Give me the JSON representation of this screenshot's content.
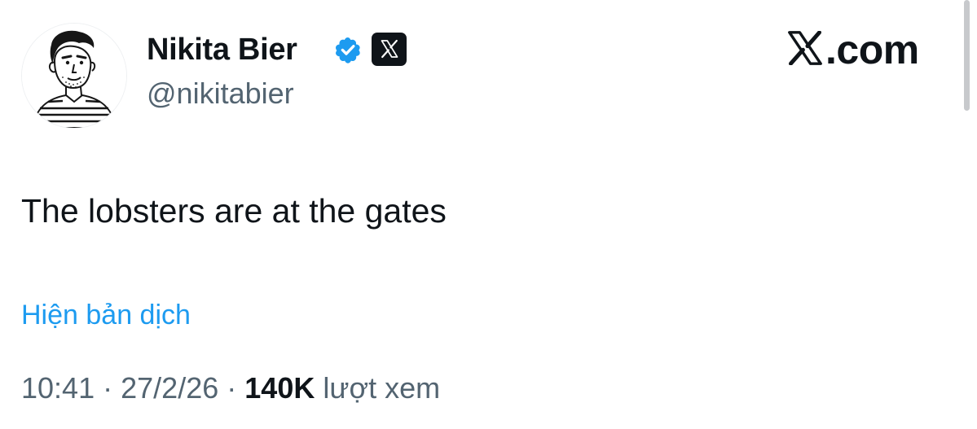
{
  "watermark": {
    "text": ".com",
    "icon": "x-logo-icon"
  },
  "author": {
    "display_name": "Nikita Bier",
    "handle": "@nikitabier",
    "avatar": "sketch-portrait-avatar",
    "verified_badge": "verified-checkmark-icon",
    "affiliate_badge": "x-logo-icon",
    "verified_color": "#1d9bf0"
  },
  "tweet": {
    "text": "The lobsters are at the gates",
    "translate_label": "Hiện bản dịch"
  },
  "meta": {
    "time": "10:41",
    "separator": "·",
    "date": "27/2/26",
    "views_count": "140K",
    "views_label": "lượt xem"
  },
  "colors": {
    "text_primary": "#0f1419",
    "text_secondary": "#536471",
    "link": "#1d9bf0",
    "background": "#ffffff"
  }
}
